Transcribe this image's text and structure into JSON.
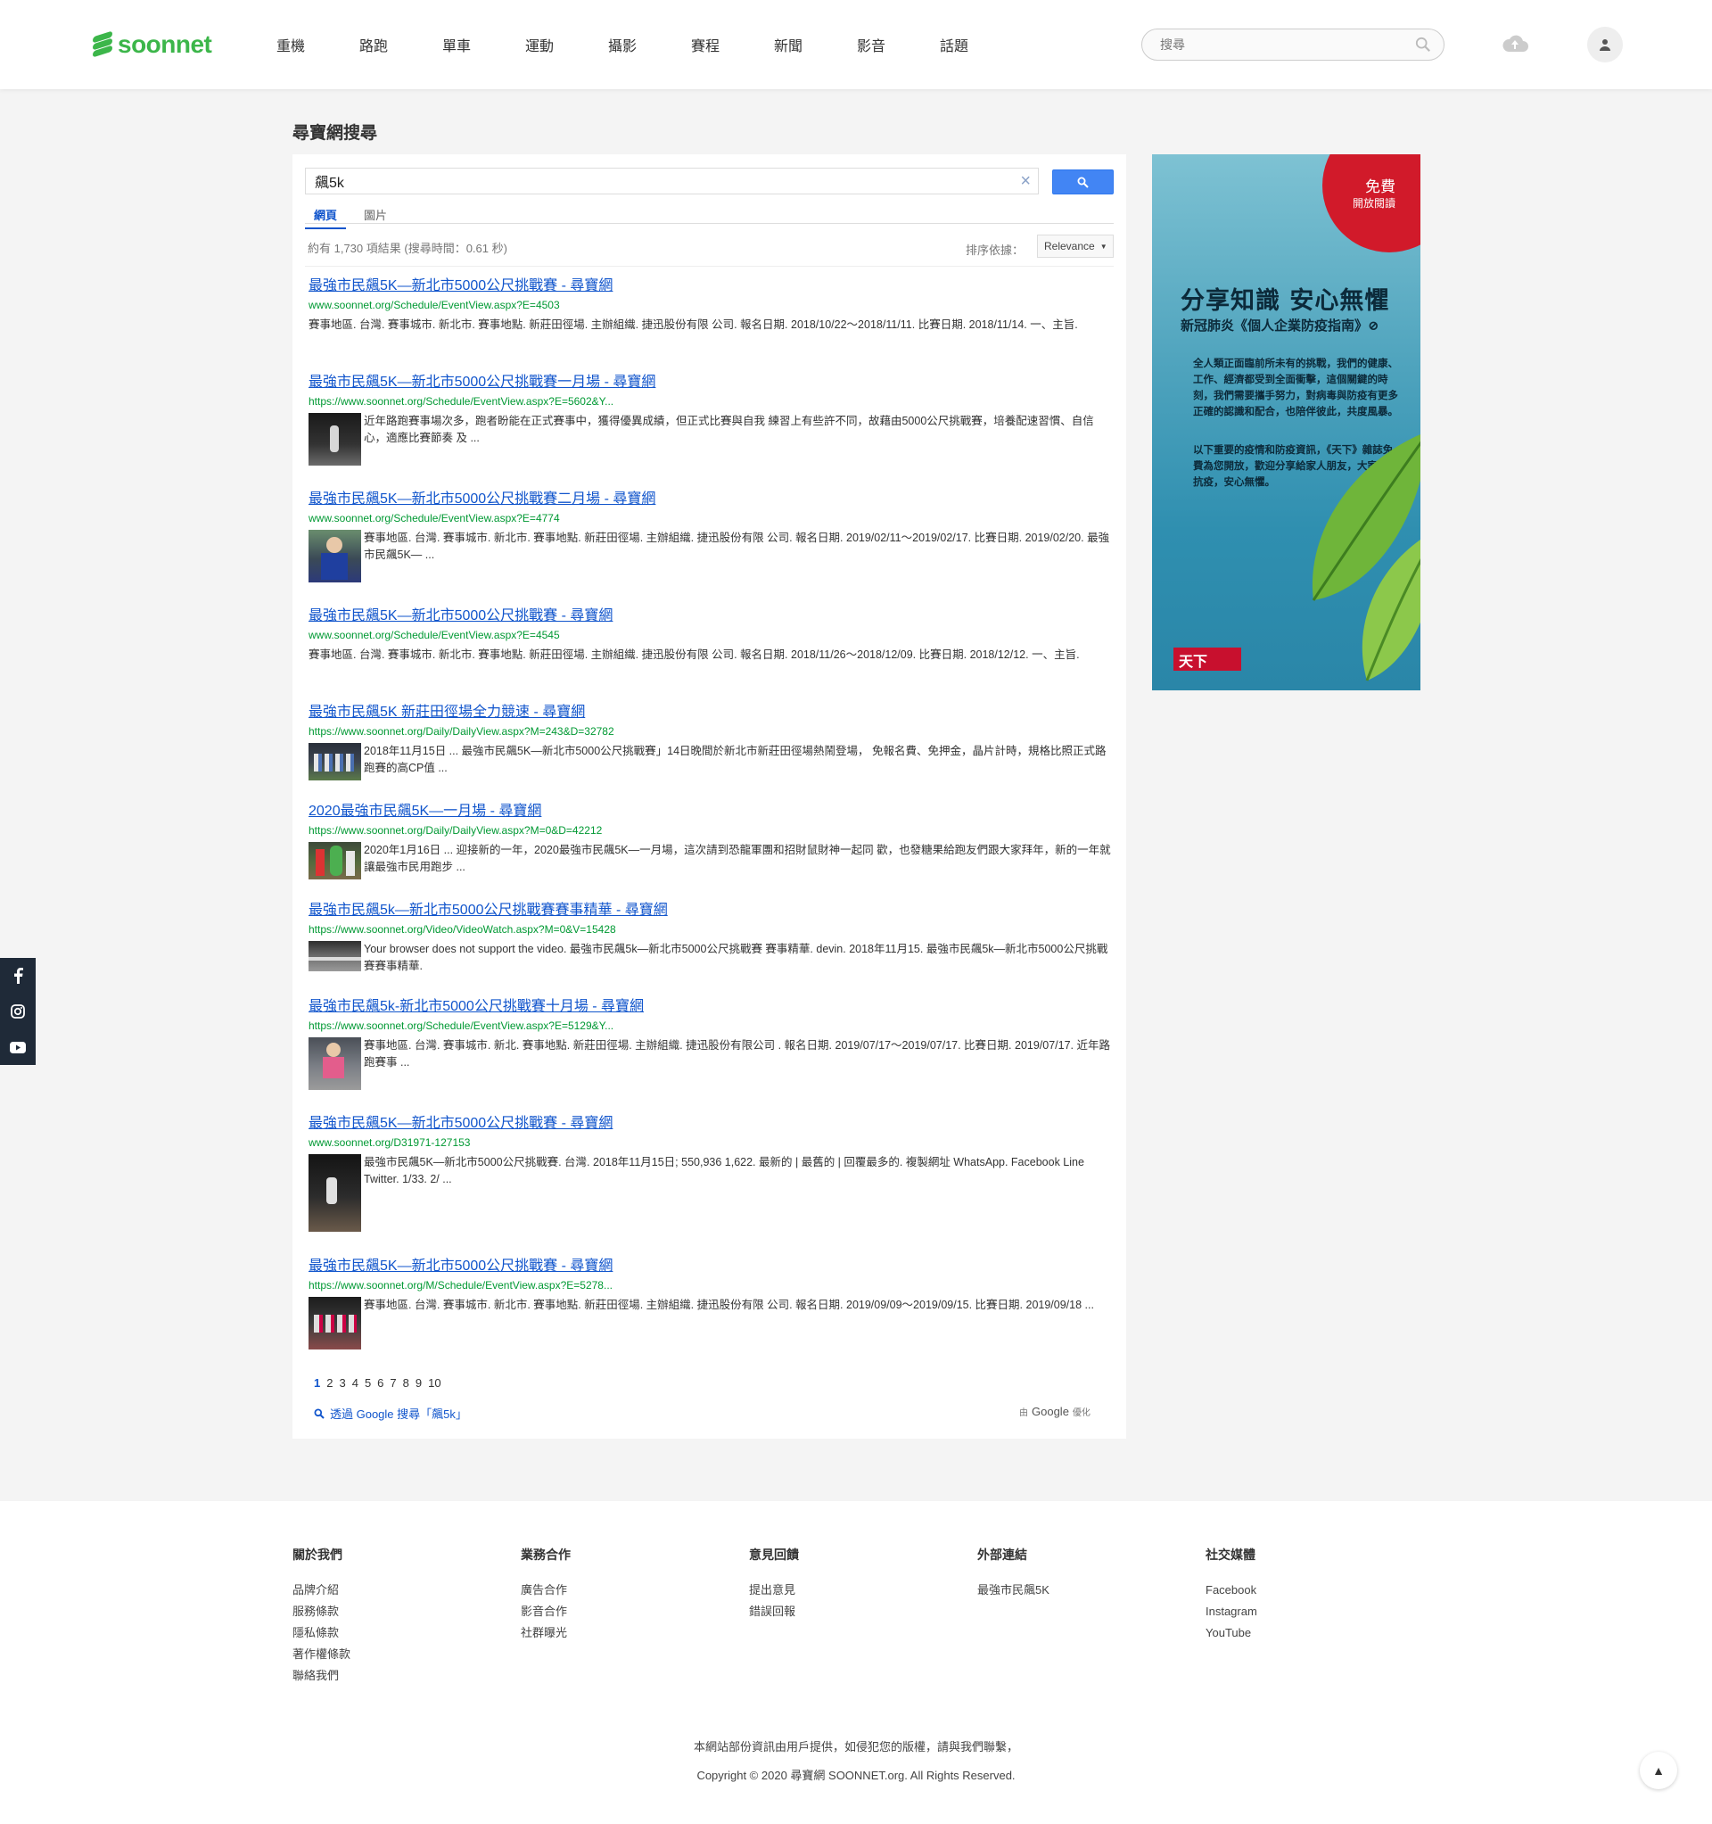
{
  "header": {
    "logo_text": "soonnet",
    "nav": [
      "重機",
      "路跑",
      "單車",
      "運動",
      "攝影",
      "賽程",
      "新聞",
      "影音",
      "話題"
    ],
    "search_placeholder": "搜尋"
  },
  "page_title": "尋寶網搜尋",
  "search": {
    "query": "飆5k",
    "tabs": [
      "網頁",
      "圖片"
    ],
    "result_info": "約有 1,730 項結果 (搜尋時間：0.61 秒)",
    "sort_label": "排序依據：",
    "sort_value": "Relevance"
  },
  "results": [
    {
      "title": "最強市民飆5K—新北市5000公尺挑戰賽 - 尋寶網",
      "url": "www.soonnet.org/Schedule/EventView.aspx?E=4503",
      "snippet": "賽事地區. 台灣. 賽事城市. 新北市. 賽事地點. 新莊田徑場. 主辦組織. 捷迅股份有限 公司. 報名日期. 2018/10/22～2018/11/11. 比賽日期. 2018/11/14. 一、主旨.",
      "thumb": ""
    },
    {
      "title": "最強市民飆5K—新北市5000公尺挑戰賽一月場 - 尋寶網",
      "url": "https://www.soonnet.org/Schedule/EventView.aspx?E=5602&Y...",
      "snippet": "近年路跑賽事場次多，跑者盼能在正式賽事中，獲得優異成績，但正式比賽與自我 練習上有些許不同，故藉由5000公尺挑戰賽，培養配速習慣、自信心，適應比賽節奏 及 ...",
      "thumb": "night"
    },
    {
      "title": "最強市民飆5K—新北市5000公尺挑戰賽二月場 - 尋寶網",
      "url": "www.soonnet.org/Schedule/EventView.aspx?E=4774",
      "snippet": "賽事地區. 台灣. 賽事城市. 新北市. 賽事地點. 新莊田徑場. 主辦組織. 捷迅股份有限 公司. 報名日期. 2019/02/11～2019/02/17. 比賽日期. 2019/02/20. 最強市民飆5K—  ...",
      "thumb": "people"
    },
    {
      "title": "最強市民飆5K—新北市5000公尺挑戰賽 - 尋寶網",
      "url": "www.soonnet.org/Schedule/EventView.aspx?E=4545",
      "snippet": "賽事地區. 台灣. 賽事城市. 新北市. 賽事地點. 新莊田徑場. 主辦組織. 捷迅股份有限 公司. 報名日期. 2018/11/26～2018/12/09. 比賽日期. 2018/12/12. 一、主旨.",
      "thumb": ""
    },
    {
      "title": "最強市民飆5K 新莊田徑場全力競速 - 尋寶網",
      "url": "https://www.soonnet.org/Daily/DailyView.aspx?M=243&D=32782",
      "snippet": "2018年11月15日 ... 最強市民飆5K—新北市5000公尺挑戰賽」14日晚間於新北市新莊田徑場熱鬧登場， 免報名費、免押金，晶片計時，規格比照正式路跑賽的高CP值 ...",
      "thumb": "group"
    },
    {
      "title": "2020最強市民飆5K—一月場 - 尋寶網",
      "url": "https://www.soonnet.org/Daily/DailyView.aspx?M=0&D=42212",
      "snippet": "2020年1月16日 ... 迎接新的一年，2020最強市民飆5K—一月場，這次請到恐龍軍團和招財鼠財神一起同 歡，也發糖果給跑友們跟大家拜年，新的一年就讓最強市民用跑步 ...",
      "thumb": "mascot"
    },
    {
      "title": "最強市民飆5k—新北市5000公尺挑戰賽賽事精華 - 尋寶網",
      "url": "https://www.soonnet.org/Video/VideoWatch.aspx?M=0&V=15428",
      "snippet": "Your browser does not support the video. 最強市民飆5k—新北市5000公尺挑戰賽 賽事精華. devin. 2018年11月15. 最強市民飆5k—新北市5000公尺挑戰賽賽事精華.",
      "thumb": "track"
    },
    {
      "title": "最強市民飆5k-新北市5000公尺挑戰賽十月場 - 尋寶網",
      "url": "https://www.soonnet.org/Schedule/EventView.aspx?E=5129&Y...",
      "snippet": "賽事地區. 台灣. 賽事城市. 新北. 賽事地點. 新莊田徑場. 主辦組織. 捷迅股份有限公司 . 報名日期. 2019/07/17～2019/07/17. 比賽日期. 2019/07/17. 近年路跑賽事 ...",
      "thumb": "runner"
    },
    {
      "title": "最強市民飆5K—新北市5000公尺挑戰賽 - 尋寶網",
      "url": "www.soonnet.org/D31971-127153",
      "snippet": "最強市民飆5K—新北市5000公尺挑戰賽. 台灣. 2018年11月15日; 550,936 1,622. 最新的 | 最舊的 | 回覆最多的. 複製網址 WhatsApp. Facebook Line Twitter. 1/33. 2/  ...",
      "thumb": "night2"
    },
    {
      "title": "最強市民飆5K—新北市5000公尺挑戰賽 - 尋寶網",
      "url": "https://www.soonnet.org/M/Schedule/EventView.aspx?E=5278...",
      "snippet": "賽事地區. 台灣. 賽事城市. 新北市. 賽事地點. 新莊田徑場. 主辦組織. 捷迅股份有限 公司. 報名日期. 2019/09/09～2019/09/15. 比賽日期. 2019/09/18 ...",
      "thumb": "crowd"
    }
  ],
  "pager": [
    "1",
    "2",
    "3",
    "4",
    "5",
    "6",
    "7",
    "8",
    "9",
    "10"
  ],
  "google_link": "透過 Google 搜尋「飆5k」",
  "google_opt": {
    "prefix": "由",
    "brand": "Google",
    "suffix": "優化"
  },
  "ad": {
    "badge1": "免費",
    "badge2": "開放閱讀",
    "h1": "分享知識 安心無懼",
    "h2": "新冠肺炎《個人企業防疫指南》⊘",
    "p1": "全人類正面臨前所未有的挑戰，我們的健康、工作、經濟都受到全面衝擊，這個關鍵的時刻，我們需要攜手努力，對病毒與防疫有更多正確的認識和配合，也陪伴彼此，共度風暴。",
    "p2": "以下重要的疫情和防疫資訊，《天下》雜誌免費為您開放，歡迎分享給家人朋友，大家合力抗疫，安心無懼。",
    "logo": "天下"
  },
  "footer": {
    "cols": [
      {
        "title": "關於我們",
        "links": [
          "品牌介紹",
          "服務條款",
          "隱私條款",
          "著作權條款",
          "聯絡我們"
        ]
      },
      {
        "title": "業務合作",
        "links": [
          "廣告合作",
          "影音合作",
          "社群曝光"
        ]
      },
      {
        "title": "意見回饋",
        "links": [
          "提出意見",
          "錯誤回報"
        ]
      },
      {
        "title": "外部連結",
        "links": [
          "最強市民飆5K"
        ]
      },
      {
        "title": "社交媒體",
        "links": [
          "Facebook",
          "Instagram",
          "YouTube"
        ]
      }
    ],
    "note": "本網站部份資訊由用戶提供，如侵犯您的版權，請與我們聯繫，",
    "copyright": "Copyright © 2020 尋寶網 SOONNET.org. All Rights Reserved."
  },
  "colors": {
    "brand": "#3cb64a",
    "link": "#1155cc",
    "url": "#009933",
    "search_button": "#4285f4"
  }
}
